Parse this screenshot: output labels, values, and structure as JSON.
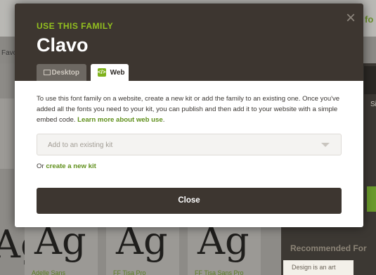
{
  "background": {
    "header_fragment": "fo",
    "favorites_fragment": "Favo",
    "side_fragment": "Si",
    "recommended_label": "Recommended For",
    "promo_card_text": "Design is an art",
    "left_glyph": "Ag",
    "cards": [
      {
        "glyph": "Ag",
        "name": "Adelle Sans"
      },
      {
        "glyph": "Ag",
        "name": "FF Tisa Pro"
      },
      {
        "glyph": "Ag",
        "name": "FF Tisa Sans Pro"
      }
    ]
  },
  "modal": {
    "eyebrow": "USE THIS FAMILY",
    "title": "Clavo",
    "close_icon_glyph": "×",
    "tabs": [
      {
        "label": "Desktop",
        "icon": "monitor-icon",
        "active": false
      },
      {
        "label": "Web",
        "icon": "web-embed-icon",
        "icon_glyph": "</>",
        "active": true
      }
    ],
    "description": "To use this font family on a website, create a new kit or add the family to an existing one. Once you've added all the fonts you need to your kit, you can publish and then add it to your website with a simple embed code.",
    "learn_more_link": "Learn more about web use",
    "learn_more_suffix": ".",
    "kit_select_placeholder": "Add to an existing kit",
    "or_prefix": "Or",
    "create_kit_link": "create a new kit",
    "close_button": "Close"
  },
  "colors": {
    "accent_green": "#93c01f",
    "link_green": "#5f8f1a",
    "header_bg": "#3d3630"
  }
}
